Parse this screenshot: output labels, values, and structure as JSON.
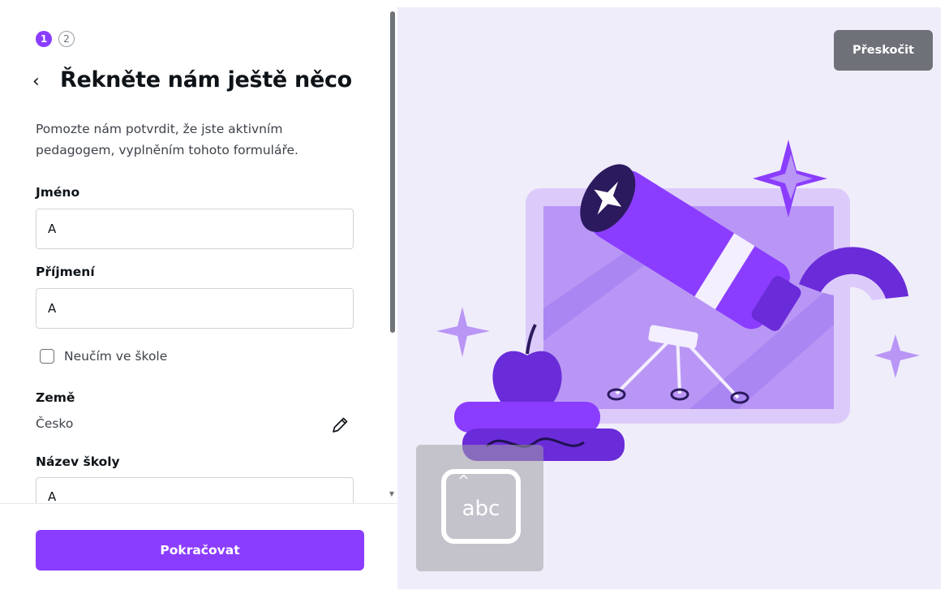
{
  "steps": {
    "current": "1",
    "next": "2"
  },
  "header": {
    "back_glyph": "‹",
    "title": "Řekněte nám ještě něco"
  },
  "description": "Pomozte nám potvrdit, že jste aktivním pedagogem, vyplněním tohoto formuláře.",
  "form": {
    "first_name_label": "Jméno",
    "first_name_value": "A",
    "last_name_label": "Příjmení",
    "last_name_value": "A",
    "not_teaching_label": "Neučím ve škole",
    "country_label": "Země",
    "country_value": "Česko",
    "school_label": "Název školy",
    "school_value": "A"
  },
  "actions": {
    "continue_label": "Pokračovat",
    "skip_label": "Přeskočit"
  },
  "keyboard_tile": {
    "text": "abc"
  },
  "colors": {
    "accent": "#8b3dff",
    "skip_bg": "#6f7179",
    "panel_bg": "#f0edfb"
  },
  "icons": [
    "chevron-left-icon",
    "pencil-icon",
    "keyboard-icon"
  ]
}
